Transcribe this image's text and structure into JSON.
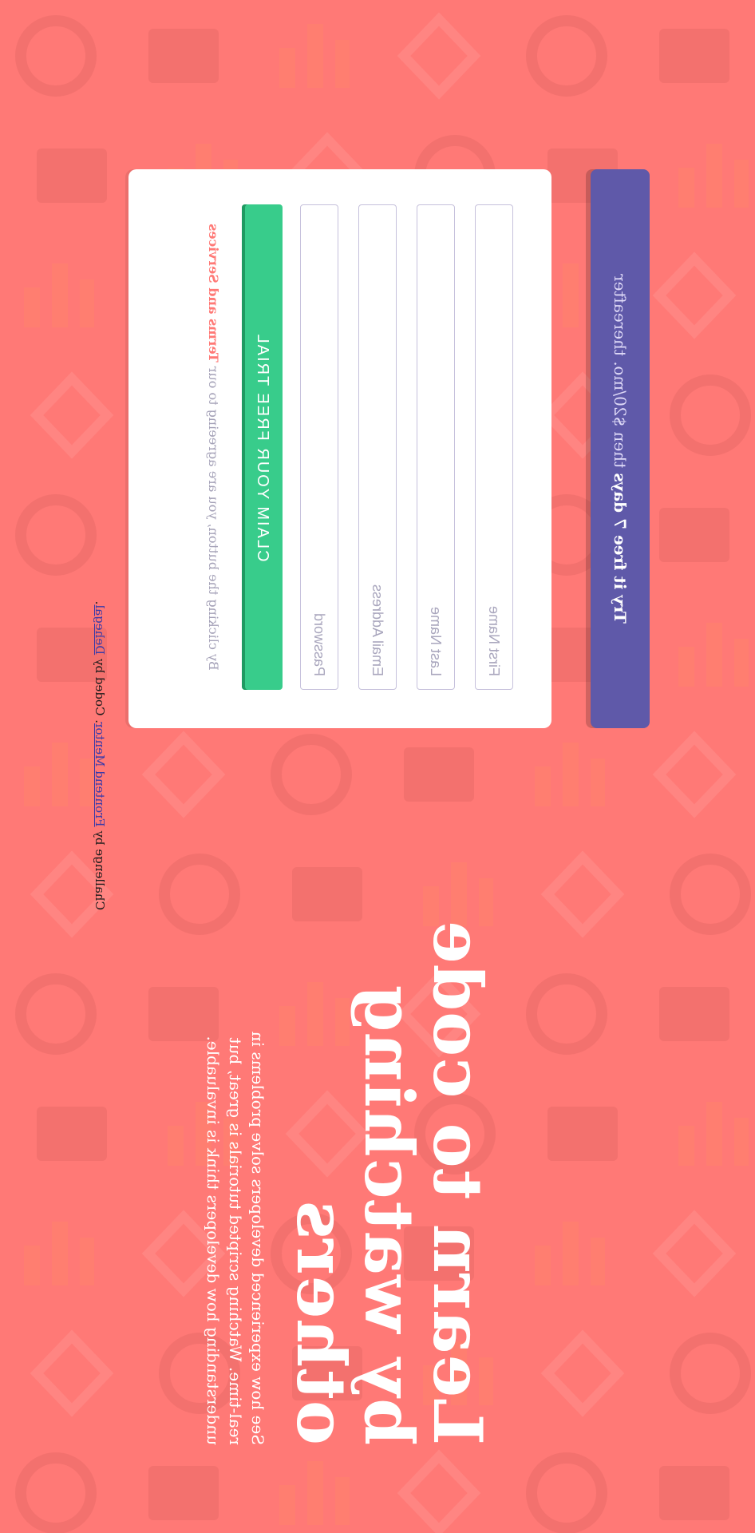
{
  "hero": {
    "title": "Learn to code by watching others",
    "description": "See how experienced developers solve problems in real-time. Watching scripted tutorials is great, but understanding how developers think is invaluable."
  },
  "trial_banner": {
    "emphasis": "Try it free 7 days",
    "rest": "then $20/mo. thereafter"
  },
  "form": {
    "first_name_placeholder": "First Name",
    "last_name_placeholder": "Last Name",
    "email_placeholder": "Email Address",
    "password_placeholder": "Password",
    "submit_label": "CLAIM YOUR FREE TRIAL",
    "terms_prefix": "By clicking the button, you are agreeing to our",
    "terms_link": "Terms and Services"
  },
  "attribution": {
    "prefix": "Challenge by",
    "link1": "Frontend Mentor",
    "middle": ". Coded by",
    "link2": "Dehegal",
    "suffix": "."
  },
  "colors": {
    "background": "#ff7976",
    "banner": "#5f59a9",
    "button": "#38cc8b",
    "accent": "#ff7976"
  },
  "background_pattern_icons": [
    "gear-icon",
    "key-icon",
    "list-icon",
    "bar-chart-icon",
    "lifebuoy-icon",
    "globe-icon",
    "rocket-icon",
    "folder-icon",
    "pencil-icon",
    "network-icon",
    "headset-icon",
    "lock-icon"
  ]
}
